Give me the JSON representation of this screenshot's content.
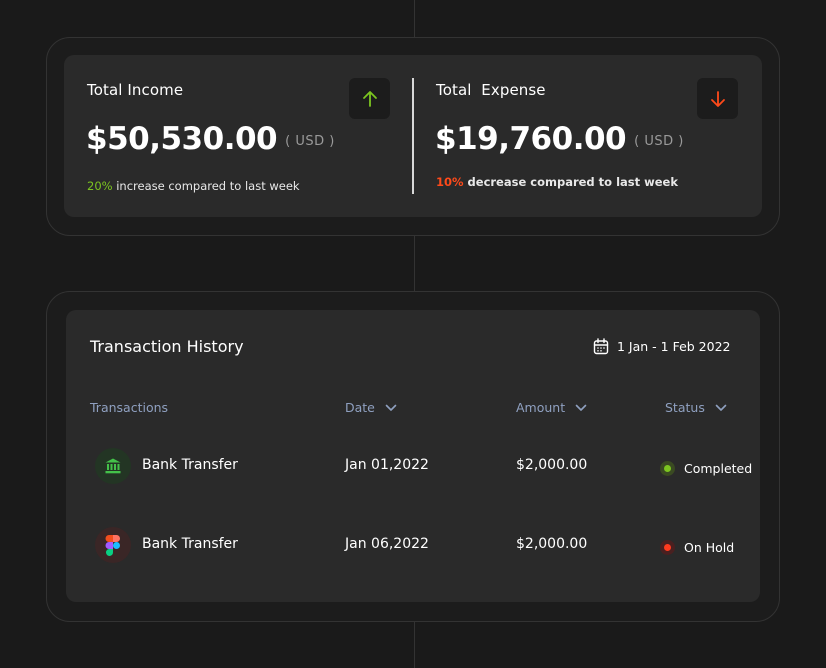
{
  "summary": {
    "income": {
      "title": "Total Income",
      "amount": "$50,530.00",
      "unit": "( USD )",
      "pct": "20%",
      "note": " increase compared to last week",
      "icon": "arrow-up-icon",
      "color": "#7cc520"
    },
    "expense": {
      "title": "Total  Expense",
      "amount": "$19,760.00",
      "unit": "( USD )",
      "pct": "10%",
      "note": " decrease compared to last week",
      "icon": "arrow-down-icon",
      "color": "#ff4a1a"
    }
  },
  "transactions": {
    "title": "Transaction History",
    "date_range": "1 Jan - 1 Feb 2022",
    "columns": {
      "transactions": "Transactions",
      "date": "Date",
      "amount": "Amount",
      "status": "Status"
    },
    "rows": [
      {
        "name": "Bank Transfer",
        "date": "Jan 01,2022",
        "amount": "$2,000.00",
        "status": "Completed",
        "icon": "bank-icon",
        "status_color": "#7cc520"
      },
      {
        "name": "Bank Transfer",
        "date": "Jan 06,2022",
        "amount": "$2,000.00",
        "status": "On Hold",
        "icon": "figma-icon",
        "status_color": "#ff3b1f"
      }
    ]
  }
}
